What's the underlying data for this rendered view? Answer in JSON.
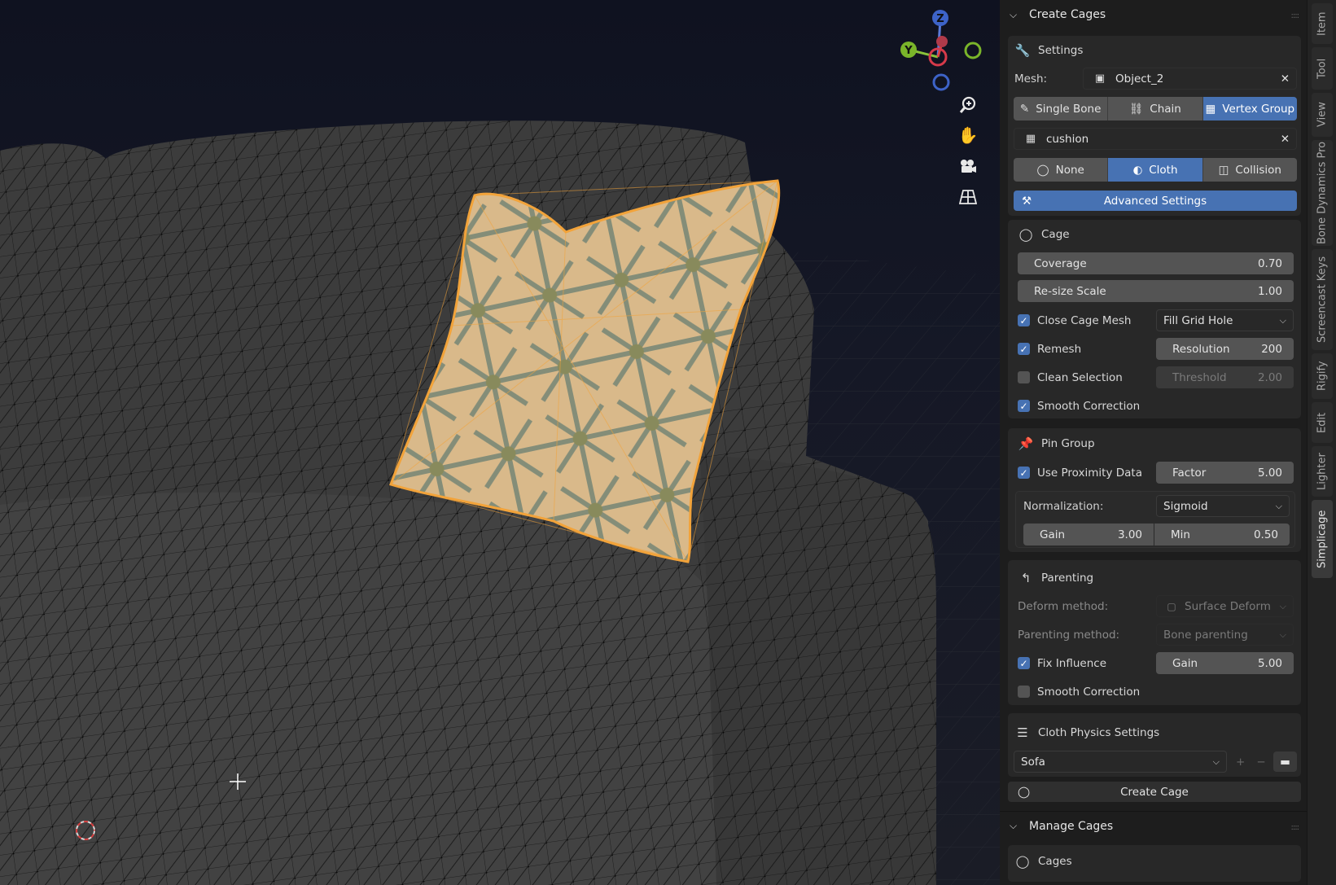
{
  "viewport": {
    "gizmo_axes": {
      "z": "Z",
      "y": "Y"
    },
    "nav_icons": [
      "zoom-icon",
      "pan-hand-icon",
      "camera-icon",
      "grid-view-icon"
    ]
  },
  "panel": {
    "create_cages": {
      "title": "Create Cages",
      "settings": {
        "title": "Settings",
        "mesh_label": "Mesh:",
        "mesh_value": "Object_2",
        "mode_buttons": [
          "Single Bone",
          "Chain",
          "Vertex Group"
        ],
        "mode_active": "Vertex Group",
        "vertex_group": "cushion",
        "physics_buttons": [
          "None",
          "Cloth",
          "Collision"
        ],
        "physics_active": "Cloth",
        "advanced_label": "Advanced Settings"
      },
      "cage": {
        "title": "Cage",
        "coverage_label": "Coverage",
        "coverage_value": "0.70",
        "resize_label": "Re-size Scale",
        "resize_value": "1.00",
        "close_cage_label": "Close Cage Mesh",
        "close_cage_checked": true,
        "close_cage_option": "Fill Grid Hole",
        "remesh_label": "Remesh",
        "remesh_checked": true,
        "resolution_label": "Resolution",
        "resolution_value": "200",
        "clean_label": "Clean Selection",
        "clean_checked": false,
        "threshold_label": "Threshold",
        "threshold_value": "2.00",
        "smooth_label": "Smooth Correction",
        "smooth_checked": true
      },
      "pin_group": {
        "title": "Pin Group",
        "proximity_label": "Use Proximity Data",
        "proximity_checked": true,
        "factor_label": "Factor",
        "factor_value": "5.00",
        "normalization_label": "Normalization:",
        "normalization_value": "Sigmoid",
        "gain_label": "Gain",
        "gain_value": "3.00",
        "min_label": "Min",
        "min_value": "0.50"
      },
      "parenting": {
        "title": "Parenting",
        "deform_label": "Deform method:",
        "deform_value": "Surface Deform",
        "parenting_label": "Parenting method:",
        "parenting_value": "Bone parenting",
        "fix_label": "Fix Influence",
        "fix_checked": true,
        "fix_gain_label": "Gain",
        "fix_gain_value": "5.00",
        "smooth_label": "Smooth Correction",
        "smooth_checked": false
      },
      "cloth_physics": {
        "title": "Cloth Physics Settings",
        "preset": "Sofa"
      },
      "create_button": "Create Cage"
    },
    "manage_cages": {
      "title": "Manage Cages",
      "cages_label": "Cages"
    }
  },
  "tabs": [
    "Item",
    "Tool",
    "View",
    "Bone Dynamics Pro",
    "Screencast Keys",
    "Rigify",
    "Edit",
    "Lighter",
    "Simplicage"
  ],
  "active_tab": "Simplicage",
  "colors": {
    "accent": "#4772b3",
    "selection": "#f2a33a",
    "panel_bg": "#1d1d1d"
  }
}
